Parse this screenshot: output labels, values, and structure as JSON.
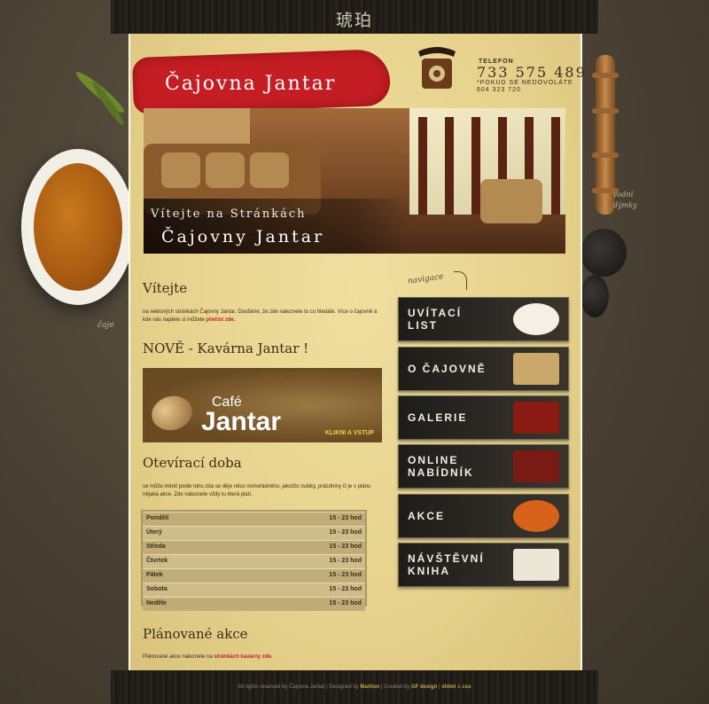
{
  "header": {
    "top_symbol": "琥珀",
    "brand": "Čajovna Jantar",
    "phone": {
      "label": "TELEFON",
      "number": "733 575 489",
      "note": "*POKUD SE NEDOVOLÁTE 604 323 720"
    }
  },
  "banner": {
    "line1": "Vítejte na Stránkách",
    "line2": "Čajovny Jantar"
  },
  "decor": {
    "left_caption": "čaje",
    "right_caption": "vodní dýmky"
  },
  "main": {
    "welcome": {
      "title": "Vítejte",
      "text": "na webových stránkách Čajovny Jantar. Doufáme, že zde naleznete to co hledáte. Více o čajovně a kde nás najdete si můžete",
      "link": "přečíst zde."
    },
    "news": {
      "title": "NOVĚ - Kavárna Jantar !",
      "ad": {
        "small": "Café",
        "big": "Jantar",
        "cta": "KLIKNI A VSTUP"
      }
    },
    "hours": {
      "title": "Otevírací doba",
      "text": "se může měnit podle toho zda se děje něco mimořádného, jakožto svátky, prázdniny či je v plánu nějaká akce. Zde naleznete vždy tu která platí.",
      "rows": [
        {
          "day": "Pondělí",
          "time": "15 - 23 hod"
        },
        {
          "day": "Úterý",
          "time": "15 - 23 hod"
        },
        {
          "day": "Středa",
          "time": "15 - 23 hod"
        },
        {
          "day": "Čtvrtek",
          "time": "15 - 23 hod"
        },
        {
          "day": "Pátek",
          "time": "15 - 23 hod"
        },
        {
          "day": "Sobota",
          "time": "15 - 23 hod"
        },
        {
          "day": "Neděle",
          "time": "15 - 23 hod"
        }
      ]
    },
    "events": {
      "title": "Plánované akce",
      "text": "Plánované akce naleznete na",
      "link": "stránkách kavárny zde."
    }
  },
  "nav": {
    "label": "navigace",
    "items": [
      {
        "line1": "UVÍTACÍ",
        "line2": "LIST"
      },
      {
        "line1": "O ČAJOVNĚ",
        "line2": ""
      },
      {
        "line1": "GALERIE",
        "line2": ""
      },
      {
        "line1": "ONLINE",
        "line2": "NABÍDNÍK"
      },
      {
        "line1": "AKCE",
        "line2": ""
      },
      {
        "line1": "NÁVŠTĚVNÍ",
        "line2": "KNIHA"
      }
    ]
  },
  "footer": {
    "rights": "All rights reserved by Čajovna Jantar | Designed by",
    "designer": "Martion",
    "created": "| Created by",
    "creator": "GF design",
    "sep": "|",
    "xhtml": "xhtml",
    "amp": "&",
    "css": "css"
  },
  "colors": {
    "accent_red": "#c41d23",
    "paper": "#e6d28c",
    "nav_bg": "#2d2a25"
  }
}
